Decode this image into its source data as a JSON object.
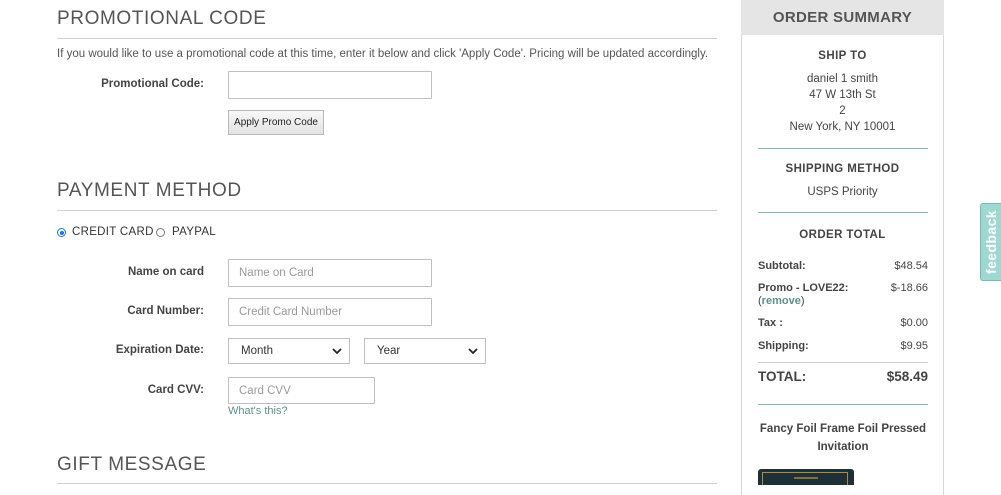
{
  "promo": {
    "title": "PROMOTIONAL CODE",
    "instructions": "If you would like to use a promotional code at this time, enter it below and click 'Apply Code'. Pricing will be updated accordingly.",
    "code_label": "Promotional Code:",
    "code_value": "",
    "apply_label": "Apply Promo Code"
  },
  "payment": {
    "title": "PAYMENT METHOD",
    "options": [
      {
        "label": "CREDIT CARD",
        "selected": true
      },
      {
        "label": "PAYPAL",
        "selected": false
      }
    ],
    "name_label": "Name on card",
    "name_placeholder": "Name on Card",
    "number_label": "Card Number:",
    "number_placeholder": "Credit Card Number",
    "expiration_label": "Expiration Date:",
    "month_value": "Month",
    "year_value": "Year",
    "cvv_label": "Card CVV:",
    "cvv_placeholder": "Card CVV",
    "cvv_help": "What's this?"
  },
  "gift": {
    "title": "GIFT MESSAGE"
  },
  "summary": {
    "title": "ORDER SUMMARY",
    "ship_to_title": "SHIP TO",
    "ship_to_lines": [
      "daniel 1 smith",
      "47 W 13th St",
      "2",
      "New York, NY 10001"
    ],
    "shipping_method_title": "SHIPPING METHOD",
    "shipping_method": "USPS Priority",
    "order_total_title": "ORDER TOTAL",
    "subtotal_label": "Subtotal:",
    "subtotal_value": "$48.54",
    "promo_label": "Promo - LOVE22:",
    "promo_value": "$-18.66",
    "remove_open": "(",
    "remove_label": "remove",
    "remove_close": ")",
    "tax_label": "Tax :",
    "tax_value": "$0.00",
    "shipping_label": "Shipping:",
    "shipping_value": "$9.95",
    "total_label": "TOTAL:",
    "total_value": "$58.49",
    "product_name": "Fancy Foil Frame Foil Pressed Invitation"
  },
  "feedback_label": "feedback",
  "colors": {
    "accent_teal": "#7fb6b1",
    "link_teal": "#5f8f8a",
    "radio_blue": "#1a73e8"
  }
}
